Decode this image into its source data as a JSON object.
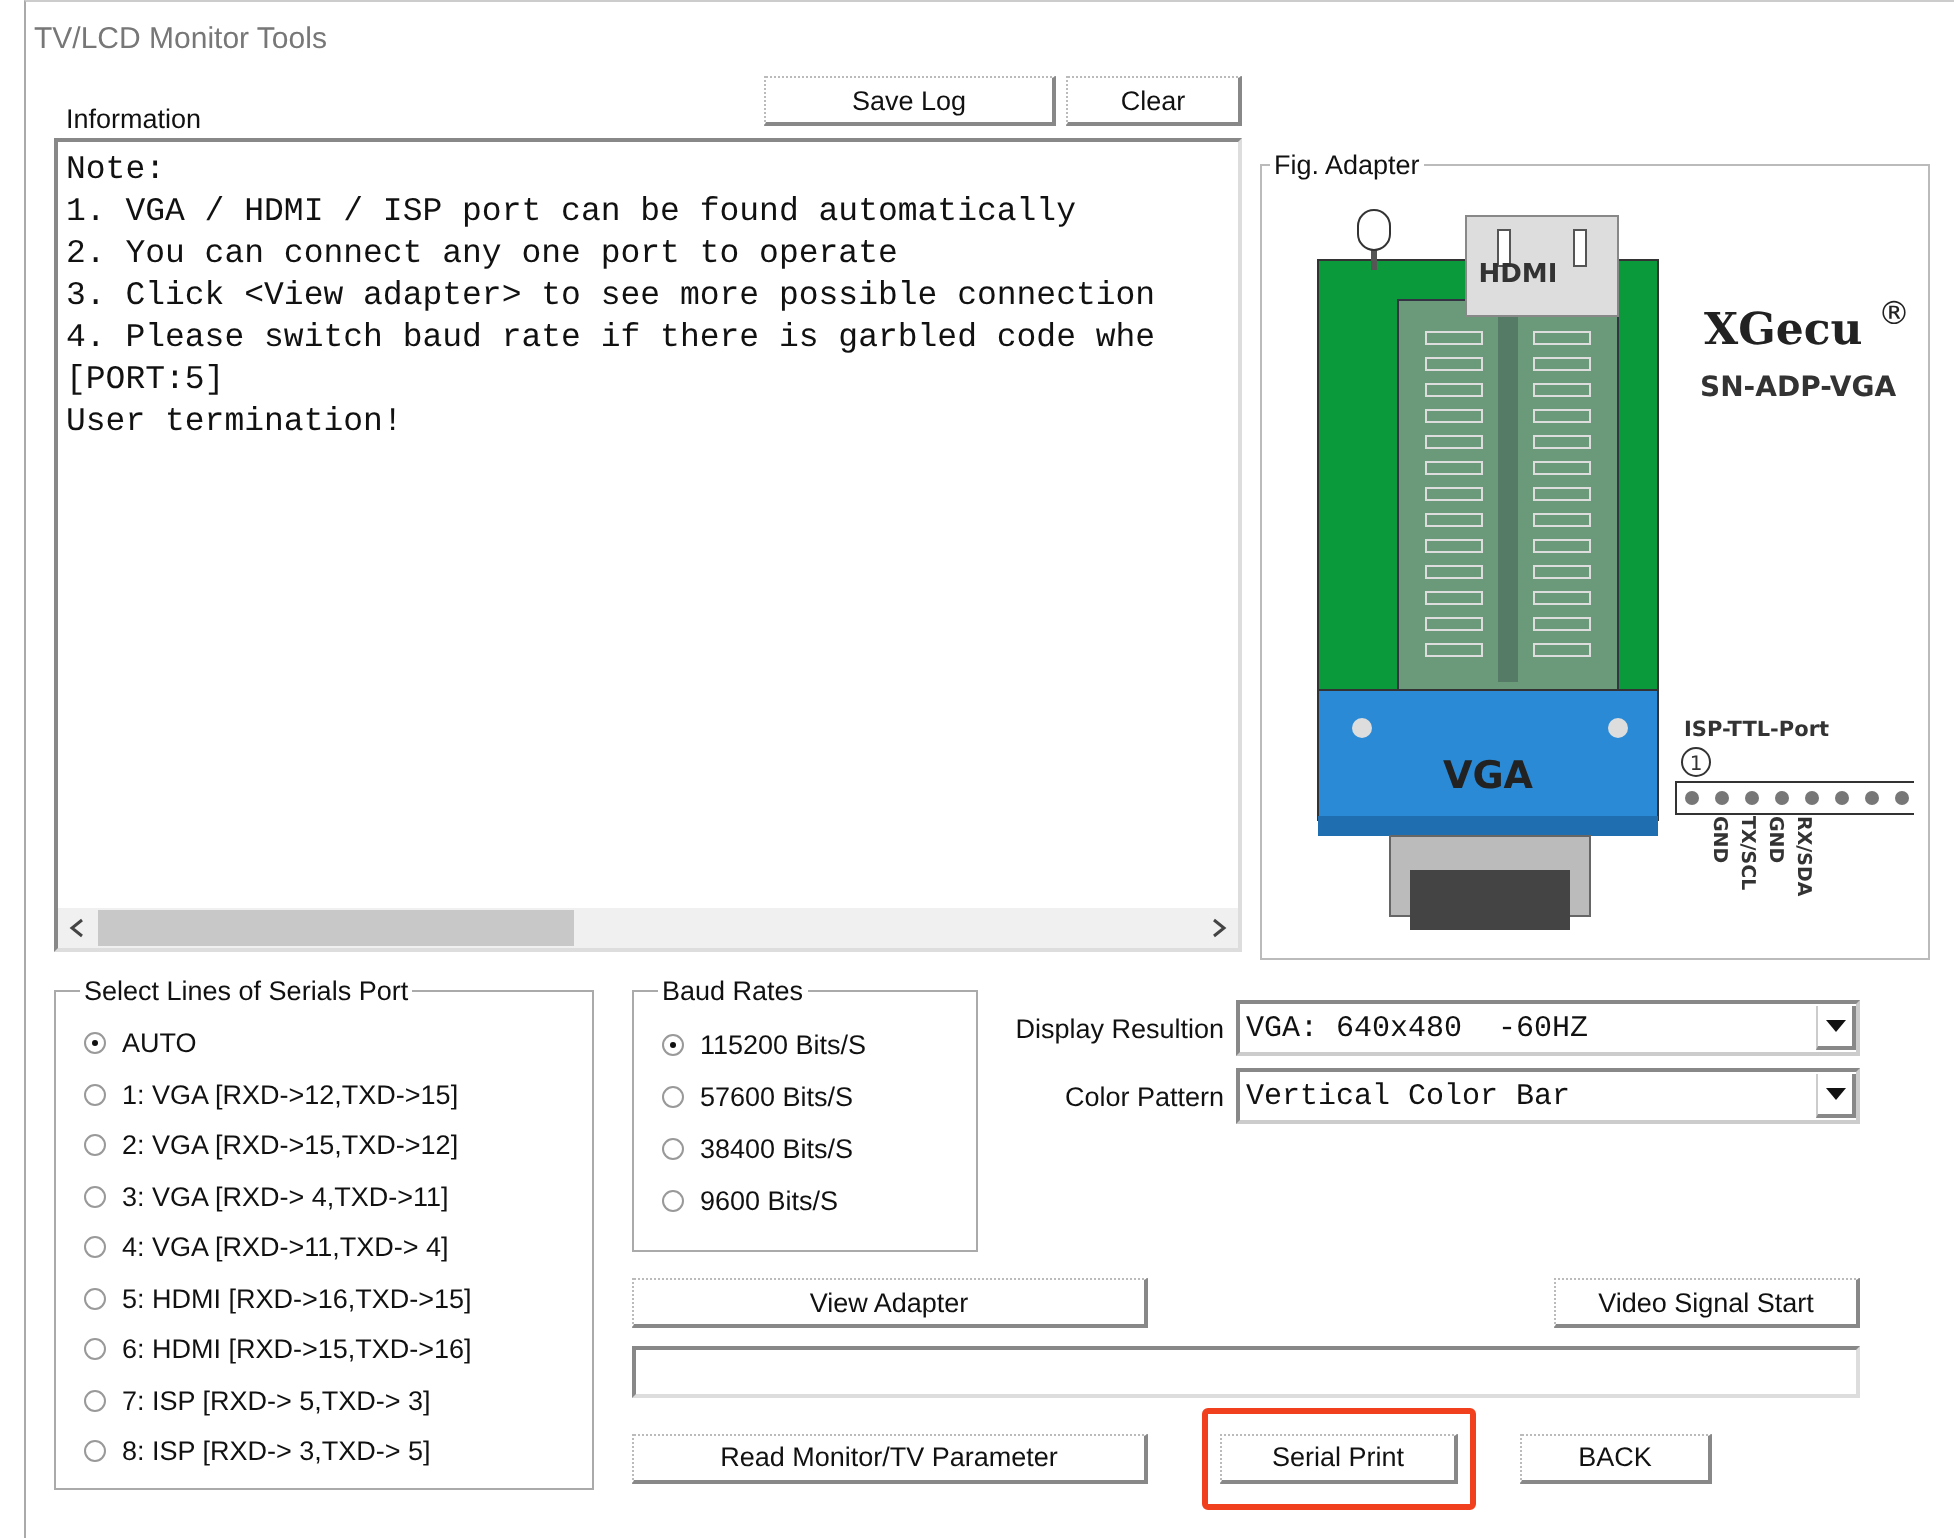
{
  "window": {
    "title": "TV/LCD Monitor Tools"
  },
  "information": {
    "label": "Information",
    "buttons": [
      "Save Log",
      "Clear"
    ],
    "log_lines": [
      "Note:",
      "1. VGA / HDMI / ISP port can be found automatically",
      "2. You can connect any one port to operate",
      "3. Click <View adapter> to see more possible connection",
      "4. Please switch baud rate if there is garbled code whe",
      "[PORT:5]",
      "User termination!"
    ]
  },
  "figure": {
    "title": "Fig. Adapter",
    "labels": {
      "hdmi": "HDMI",
      "vga": "VGA",
      "brand": "XGecu",
      "registered": "®",
      "model": "SN-ADP-VGA",
      "port": "ISP-TTL-Port",
      "pin_one": "1",
      "pins": [
        "GND",
        "TX/SCL",
        "GND",
        "RX/SDA"
      ]
    }
  },
  "serial_lines": {
    "title": "Select Lines of Serials Port",
    "options": [
      {
        "label": "AUTO",
        "selected": true
      },
      {
        "label": "1: VGA [RXD->12,TXD->15]",
        "selected": false
      },
      {
        "label": "2: VGA [RXD->15,TXD->12]",
        "selected": false
      },
      {
        "label": "3: VGA [RXD-> 4,TXD->11]",
        "selected": false
      },
      {
        "label": "4: VGA [RXD->11,TXD-> 4]",
        "selected": false
      },
      {
        "label": "5: HDMI [RXD->16,TXD->15]",
        "selected": false
      },
      {
        "label": "6: HDMI [RXD->15,TXD->16]",
        "selected": false
      },
      {
        "label": "7: ISP [RXD-> 5,TXD-> 3]",
        "selected": false
      },
      {
        "label": "8: ISP [RXD-> 3,TXD-> 5]",
        "selected": false
      }
    ]
  },
  "baud_rates": {
    "title": "Baud Rates",
    "options": [
      {
        "label": "115200 Bits/S",
        "selected": true
      },
      {
        "label": "57600 Bits/S",
        "selected": false
      },
      {
        "label": "38400 Bits/S",
        "selected": false
      },
      {
        "label": "9600 Bits/S",
        "selected": false
      }
    ]
  },
  "settings": [
    {
      "label": "Display Resultion",
      "value": "VGA: 640x480  -60HZ"
    },
    {
      "label": "Color Pattern",
      "value": "Vertical Color Bar"
    }
  ],
  "progress": {
    "level": 0
  },
  "buttons": {
    "view_adapter": "View Adapter",
    "video_signal": "Video Signal Start",
    "read_parameter": "Read Monitor/TV Parameter",
    "bottom": [
      {
        "label": "Serial Print",
        "highlighted": true
      },
      {
        "label": "BACK",
        "highlighted": false
      }
    ]
  }
}
